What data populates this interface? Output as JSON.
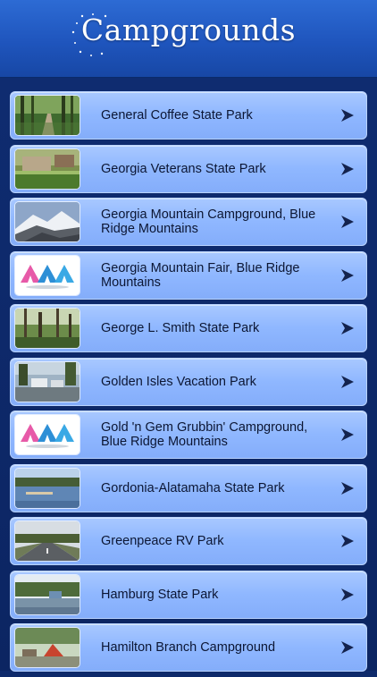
{
  "header": {
    "title": "Campgrounds"
  },
  "colors": {
    "header_blue": "#2d6bd4",
    "list_background": "#0e2a6b",
    "row_fill": "#93b9ff",
    "text": "#0c1633",
    "arrow": "#14234d"
  },
  "items": [
    {
      "label": "General Coffee State Park",
      "thumbnail": "forest-boardwalk-photo"
    },
    {
      "label": "Georgia Veterans State Park",
      "thumbnail": "park-sign-photo"
    },
    {
      "label": "Georgia Mountain Campground, Blue Ridge Mountains",
      "thumbnail": "snowy-mountain-photo"
    },
    {
      "label": "Georgia Mountain Fair, Blue Ridge Mountains",
      "thumbnail": "tents-logo"
    },
    {
      "label": "George L. Smith State Park",
      "thumbnail": "swamp-trees-photo"
    },
    {
      "label": "Golden Isles Vacation Park",
      "thumbnail": "rv-park-photo"
    },
    {
      "label": "Gold 'n Gem Grubbin' Campground, Blue Ridge Mountains",
      "thumbnail": "tents-logo"
    },
    {
      "label": "Gordonia-Alatamaha State Park",
      "thumbnail": "lake-dock-photo"
    },
    {
      "label": "Greenpeace RV Park",
      "thumbnail": "road-photo"
    },
    {
      "label": "Hamburg State Park",
      "thumbnail": "lake-cabin-photo"
    },
    {
      "label": "Hamilton Branch Campground",
      "thumbnail": "campsite-photo"
    }
  ]
}
